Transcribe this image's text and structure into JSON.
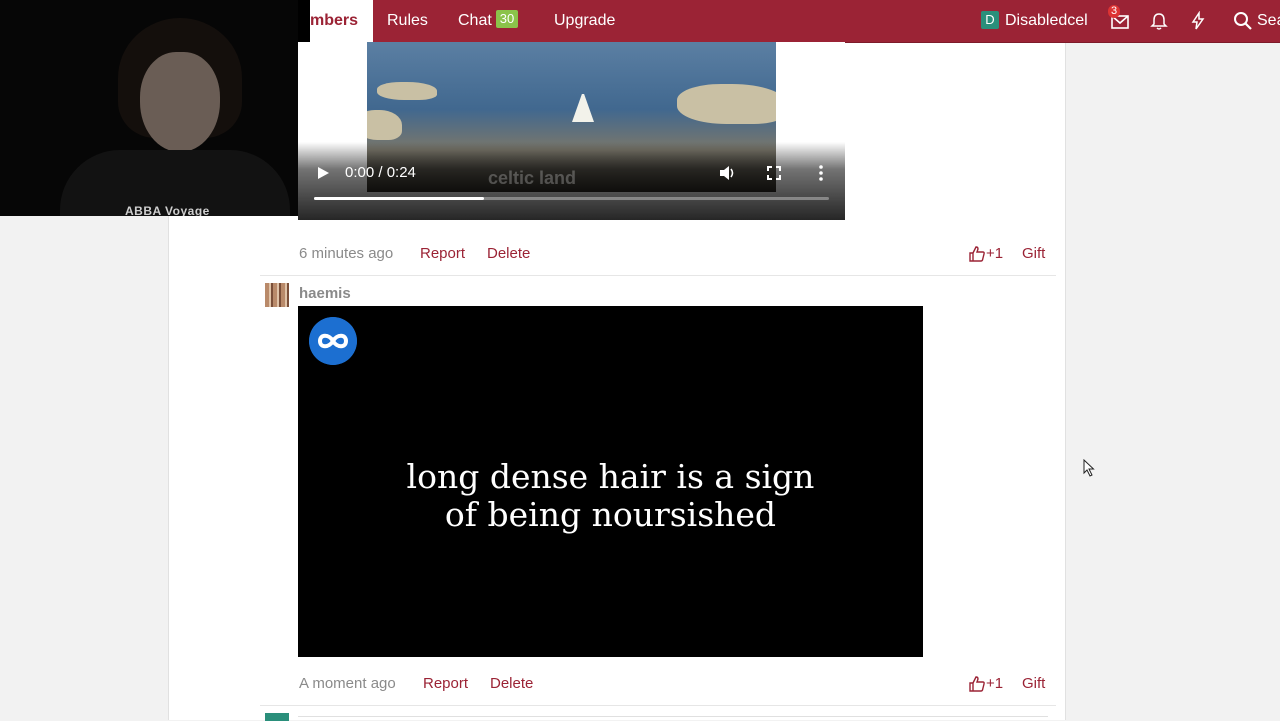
{
  "nav": {
    "members_partial": "mbers",
    "rules": "Rules",
    "chat": "Chat",
    "chat_count": "30",
    "upgrade": "Upgrade",
    "username": "Disabledcel",
    "user_initial": "D",
    "inbox_count": "3",
    "search_partial": "Sea",
    "icons": [
      "inbox-icon",
      "bell-icon",
      "bolt-icon",
      "search-icon"
    ],
    "colors": {
      "brand": "#9b2335",
      "chat_badge": "#8bc34a",
      "avatar": "#2a8f7b"
    }
  },
  "webcam": {
    "shirt_text": "ABBA Voyage"
  },
  "post1": {
    "video": {
      "time": "0:00 / 0:24",
      "watermark": "celtic land",
      "progress": 0.33
    },
    "time": "6 minutes ago",
    "report": "Report",
    "delete": "Delete",
    "likes": "+1",
    "gift": "Gift"
  },
  "post2": {
    "author": "haemis",
    "video": {
      "caption_line1": "long dense hair is a sign",
      "caption_line2": "of being noursished"
    },
    "time": "A moment ago",
    "report": "Report",
    "delete": "Delete",
    "likes": "+1",
    "gift": "Gift"
  }
}
